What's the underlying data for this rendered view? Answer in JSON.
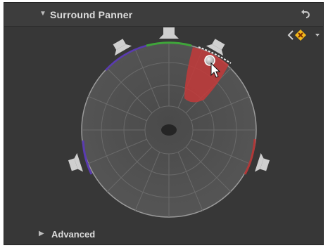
{
  "header": {
    "title": "Surround Panner",
    "reset_icon": "undo-arrow-icon"
  },
  "keyframe": {
    "prev_icon": "chevron-left-icon",
    "keyframe_icon": "keyframe-delete-icon",
    "menu_icon": "triangle-down-icon",
    "accent_color": "#f2b81a"
  },
  "panner": {
    "speakers": [
      "center",
      "front-left",
      "front-right",
      "surround-left",
      "surround-right"
    ],
    "active_region_color": "#c33a3a",
    "front_arc_color": "#3fa53a",
    "left_arc_color": "#5a3bb0",
    "right_arc_color": "#b03838"
  },
  "footer": {
    "title": "Advanced",
    "disclosure_icon": "triangle-right-icon"
  }
}
